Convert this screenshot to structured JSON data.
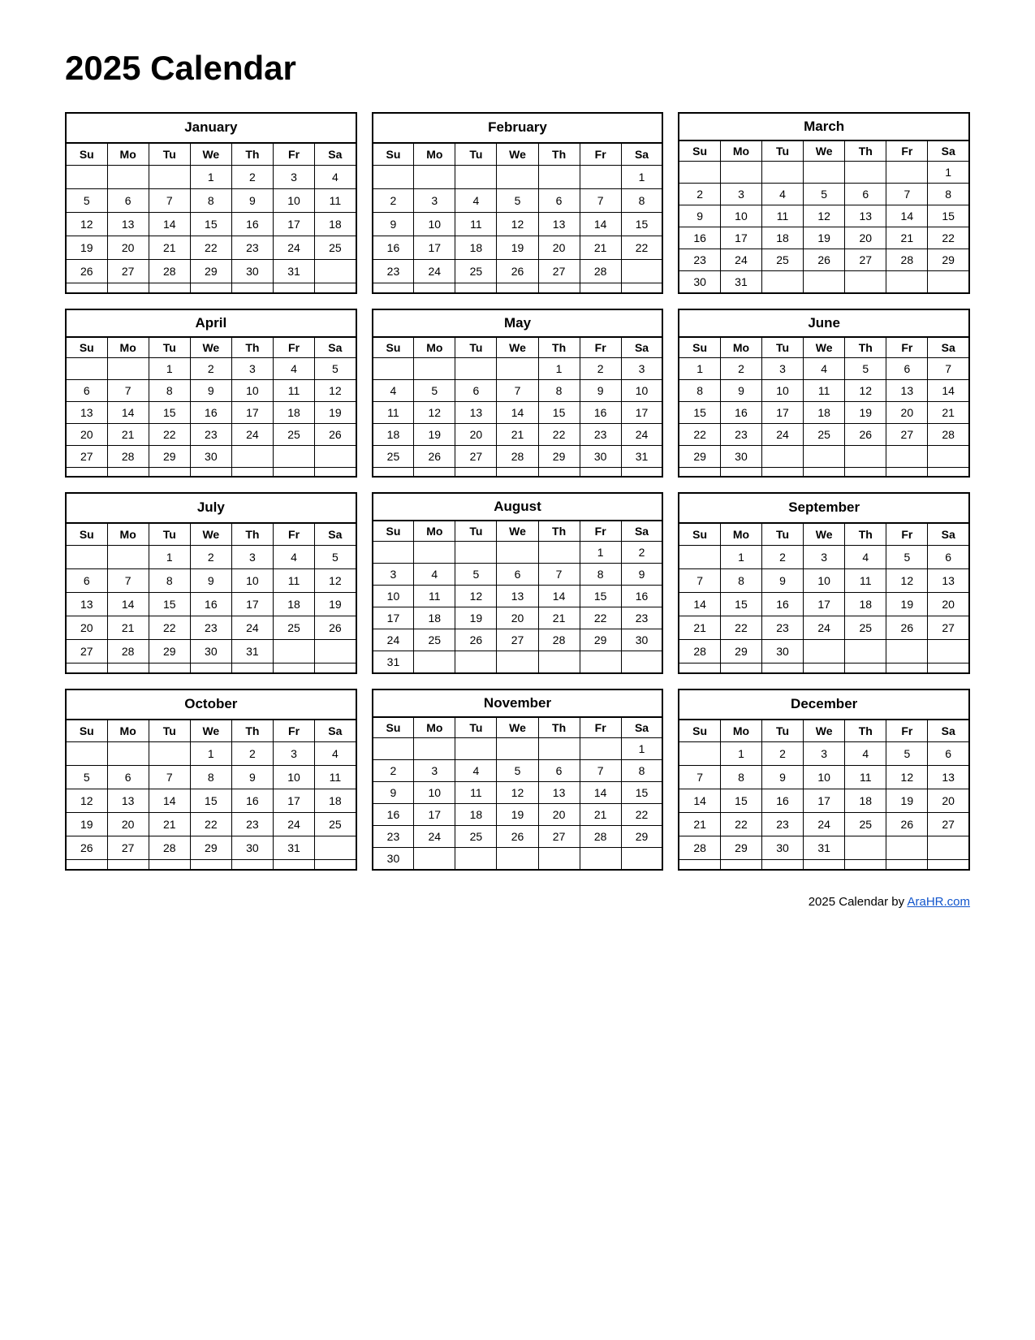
{
  "title": "2025 Calendar",
  "footer": {
    "text": "2025  Calendar by ",
    "link_text": "AraHR.com",
    "link_url": "AraHR.com"
  },
  "months": [
    {
      "name": "January",
      "days": [
        "Su",
        "Mo",
        "Tu",
        "We",
        "Th",
        "Fr",
        "Sa"
      ],
      "weeks": [
        [
          "",
          "",
          "",
          "1",
          "2",
          "3",
          "4"
        ],
        [
          "5",
          "6",
          "7",
          "8",
          "9",
          "10",
          "11"
        ],
        [
          "12",
          "13",
          "14",
          "15",
          "16",
          "17",
          "18"
        ],
        [
          "19",
          "20",
          "21",
          "22",
          "23",
          "24",
          "25"
        ],
        [
          "26",
          "27",
          "28",
          "29",
          "30",
          "31",
          ""
        ],
        [
          "",
          "",
          "",
          "",
          "",
          "",
          ""
        ]
      ]
    },
    {
      "name": "February",
      "days": [
        "Su",
        "Mo",
        "Tu",
        "We",
        "Th",
        "Fr",
        "Sa"
      ],
      "weeks": [
        [
          "",
          "",
          "",
          "",
          "",
          "",
          "1"
        ],
        [
          "2",
          "3",
          "4",
          "5",
          "6",
          "7",
          "8"
        ],
        [
          "9",
          "10",
          "11",
          "12",
          "13",
          "14",
          "15"
        ],
        [
          "16",
          "17",
          "18",
          "19",
          "20",
          "21",
          "22"
        ],
        [
          "23",
          "24",
          "25",
          "26",
          "27",
          "28",
          ""
        ],
        [
          "",
          "",
          "",
          "",
          "",
          "",
          ""
        ]
      ]
    },
    {
      "name": "March",
      "days": [
        "Su",
        "Mo",
        "Tu",
        "We",
        "Th",
        "Fr",
        "Sa"
      ],
      "weeks": [
        [
          "",
          "",
          "",
          "",
          "",
          "",
          "1"
        ],
        [
          "2",
          "3",
          "4",
          "5",
          "6",
          "7",
          "8"
        ],
        [
          "9",
          "10",
          "11",
          "12",
          "13",
          "14",
          "15"
        ],
        [
          "16",
          "17",
          "18",
          "19",
          "20",
          "21",
          "22"
        ],
        [
          "23",
          "24",
          "25",
          "26",
          "27",
          "28",
          "29"
        ],
        [
          "30",
          "31",
          "",
          "",
          "",
          "",
          ""
        ]
      ]
    },
    {
      "name": "April",
      "days": [
        "Su",
        "Mo",
        "Tu",
        "We",
        "Th",
        "Fr",
        "Sa"
      ],
      "weeks": [
        [
          "",
          "",
          "1",
          "2",
          "3",
          "4",
          "5"
        ],
        [
          "6",
          "7",
          "8",
          "9",
          "10",
          "11",
          "12"
        ],
        [
          "13",
          "14",
          "15",
          "16",
          "17",
          "18",
          "19"
        ],
        [
          "20",
          "21",
          "22",
          "23",
          "24",
          "25",
          "26"
        ],
        [
          "27",
          "28",
          "29",
          "30",
          "",
          "",
          ""
        ],
        [
          "",
          "",
          "",
          "",
          "",
          "",
          ""
        ]
      ]
    },
    {
      "name": "May",
      "days": [
        "Su",
        "Mo",
        "Tu",
        "We",
        "Th",
        "Fr",
        "Sa"
      ],
      "weeks": [
        [
          "",
          "",
          "",
          "",
          "1",
          "2",
          "3"
        ],
        [
          "4",
          "5",
          "6",
          "7",
          "8",
          "9",
          "10"
        ],
        [
          "11",
          "12",
          "13",
          "14",
          "15",
          "16",
          "17"
        ],
        [
          "18",
          "19",
          "20",
          "21",
          "22",
          "23",
          "24"
        ],
        [
          "25",
          "26",
          "27",
          "28",
          "29",
          "30",
          "31"
        ],
        [
          "",
          "",
          "",
          "",
          "",
          "",
          ""
        ]
      ]
    },
    {
      "name": "June",
      "days": [
        "Su",
        "Mo",
        "Tu",
        "We",
        "Th",
        "Fr",
        "Sa"
      ],
      "weeks": [
        [
          "1",
          "2",
          "3",
          "4",
          "5",
          "6",
          "7"
        ],
        [
          "8",
          "9",
          "10",
          "11",
          "12",
          "13",
          "14"
        ],
        [
          "15",
          "16",
          "17",
          "18",
          "19",
          "20",
          "21"
        ],
        [
          "22",
          "23",
          "24",
          "25",
          "26",
          "27",
          "28"
        ],
        [
          "29",
          "30",
          "",
          "",
          "",
          "",
          ""
        ],
        [
          "",
          "",
          "",
          "",
          "",
          "",
          ""
        ]
      ]
    },
    {
      "name": "July",
      "days": [
        "Su",
        "Mo",
        "Tu",
        "We",
        "Th",
        "Fr",
        "Sa"
      ],
      "weeks": [
        [
          "",
          "",
          "1",
          "2",
          "3",
          "4",
          "5"
        ],
        [
          "6",
          "7",
          "8",
          "9",
          "10",
          "11",
          "12"
        ],
        [
          "13",
          "14",
          "15",
          "16",
          "17",
          "18",
          "19"
        ],
        [
          "20",
          "21",
          "22",
          "23",
          "24",
          "25",
          "26"
        ],
        [
          "27",
          "28",
          "29",
          "30",
          "31",
          "",
          ""
        ],
        [
          "",
          "",
          "",
          "",
          "",
          "",
          ""
        ]
      ]
    },
    {
      "name": "August",
      "days": [
        "Su",
        "Mo",
        "Tu",
        "We",
        "Th",
        "Fr",
        "Sa"
      ],
      "weeks": [
        [
          "",
          "",
          "",
          "",
          "",
          "1",
          "2"
        ],
        [
          "3",
          "4",
          "5",
          "6",
          "7",
          "8",
          "9"
        ],
        [
          "10",
          "11",
          "12",
          "13",
          "14",
          "15",
          "16"
        ],
        [
          "17",
          "18",
          "19",
          "20",
          "21",
          "22",
          "23"
        ],
        [
          "24",
          "25",
          "26",
          "27",
          "28",
          "29",
          "30"
        ],
        [
          "31",
          "",
          "",
          "",
          "",
          "",
          ""
        ]
      ]
    },
    {
      "name": "September",
      "days": [
        "Su",
        "Mo",
        "Tu",
        "We",
        "Th",
        "Fr",
        "Sa"
      ],
      "weeks": [
        [
          "",
          "1",
          "2",
          "3",
          "4",
          "5",
          "6"
        ],
        [
          "7",
          "8",
          "9",
          "10",
          "11",
          "12",
          "13"
        ],
        [
          "14",
          "15",
          "16",
          "17",
          "18",
          "19",
          "20"
        ],
        [
          "21",
          "22",
          "23",
          "24",
          "25",
          "26",
          "27"
        ],
        [
          "28",
          "29",
          "30",
          "",
          "",
          "",
          ""
        ],
        [
          "",
          "",
          "",
          "",
          "",
          "",
          ""
        ]
      ]
    },
    {
      "name": "October",
      "days": [
        "Su",
        "Mo",
        "Tu",
        "We",
        "Th",
        "Fr",
        "Sa"
      ],
      "weeks": [
        [
          "",
          "",
          "",
          "1",
          "2",
          "3",
          "4"
        ],
        [
          "5",
          "6",
          "7",
          "8",
          "9",
          "10",
          "11"
        ],
        [
          "12",
          "13",
          "14",
          "15",
          "16",
          "17",
          "18"
        ],
        [
          "19",
          "20",
          "21",
          "22",
          "23",
          "24",
          "25"
        ],
        [
          "26",
          "27",
          "28",
          "29",
          "30",
          "31",
          ""
        ],
        [
          "",
          "",
          "",
          "",
          "",
          "",
          ""
        ]
      ]
    },
    {
      "name": "November",
      "days": [
        "Su",
        "Mo",
        "Tu",
        "We",
        "Th",
        "Fr",
        "Sa"
      ],
      "weeks": [
        [
          "",
          "",
          "",
          "",
          "",
          "",
          "1"
        ],
        [
          "2",
          "3",
          "4",
          "5",
          "6",
          "7",
          "8"
        ],
        [
          "9",
          "10",
          "11",
          "12",
          "13",
          "14",
          "15"
        ],
        [
          "16",
          "17",
          "18",
          "19",
          "20",
          "21",
          "22"
        ],
        [
          "23",
          "24",
          "25",
          "26",
          "27",
          "28",
          "29"
        ],
        [
          "30",
          "",
          "",
          "",
          "",
          "",
          ""
        ]
      ]
    },
    {
      "name": "December",
      "days": [
        "Su",
        "Mo",
        "Tu",
        "We",
        "Th",
        "Fr",
        "Sa"
      ],
      "weeks": [
        [
          "",
          "1",
          "2",
          "3",
          "4",
          "5",
          "6"
        ],
        [
          "7",
          "8",
          "9",
          "10",
          "11",
          "12",
          "13"
        ],
        [
          "14",
          "15",
          "16",
          "17",
          "18",
          "19",
          "20"
        ],
        [
          "21",
          "22",
          "23",
          "24",
          "25",
          "26",
          "27"
        ],
        [
          "28",
          "29",
          "30",
          "31",
          "",
          "",
          ""
        ],
        [
          "",
          "",
          "",
          "",
          "",
          "",
          ""
        ]
      ]
    }
  ]
}
